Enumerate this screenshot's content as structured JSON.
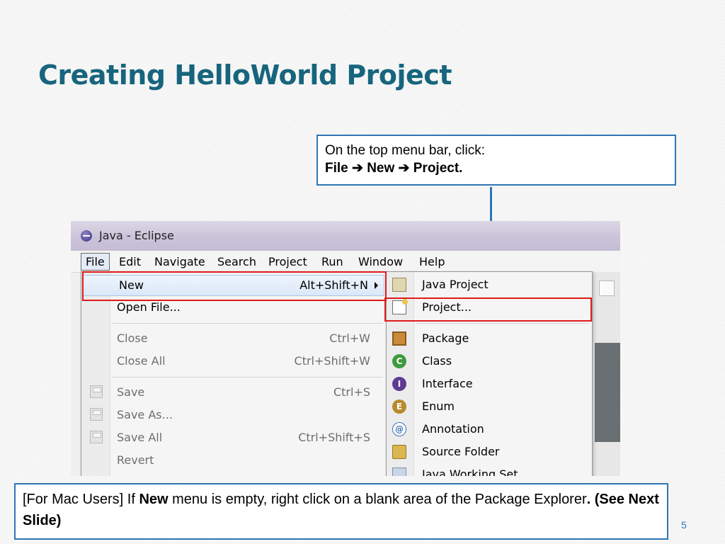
{
  "slide": {
    "title": "Creating HelloWorld Project",
    "page_number": "5"
  },
  "callout_top": {
    "line1": "On the top menu bar, click:",
    "line2": "File ➔ New ➔ Project."
  },
  "callout_bottom": {
    "part1": "[For Mac Users] If ",
    "part2": "New",
    "part3": " menu is empty, right click on a blank area of the Package Explorer",
    "part4": ". (See Next Slide)"
  },
  "eclipse": {
    "window_title": "Java - Eclipse",
    "menubar": [
      "File",
      "Edit",
      "Navigate",
      "Search",
      "Project",
      "Run",
      "Window",
      "Help"
    ],
    "file_menu": [
      {
        "label": "New",
        "shortcut": "Alt+Shift+N",
        "submenu": true,
        "enabled": true
      },
      {
        "label": "Open File...",
        "shortcut": "",
        "enabled": true
      },
      {
        "label": "Close",
        "shortcut": "Ctrl+W",
        "enabled": false
      },
      {
        "label": "Close All",
        "shortcut": "Ctrl+Shift+W",
        "enabled": false
      },
      {
        "label": "Save",
        "shortcut": "Ctrl+S",
        "enabled": false,
        "icon": "save-icon"
      },
      {
        "label": "Save As...",
        "shortcut": "",
        "enabled": false,
        "icon": "save-as-icon"
      },
      {
        "label": "Save All",
        "shortcut": "Ctrl+Shift+S",
        "enabled": false,
        "icon": "save-all-icon"
      },
      {
        "label": "Revert",
        "shortcut": "",
        "enabled": false
      }
    ],
    "new_submenu": [
      {
        "label": "Java Project",
        "icon": "java-project-icon"
      },
      {
        "label": "Project...",
        "icon": "project-icon"
      },
      {
        "label": "Package",
        "icon": "package-icon"
      },
      {
        "label": "Class",
        "icon": "class-icon",
        "glyph": "C"
      },
      {
        "label": "Interface",
        "icon": "interface-icon",
        "glyph": "I"
      },
      {
        "label": "Enum",
        "icon": "enum-icon",
        "glyph": "E"
      },
      {
        "label": "Annotation",
        "icon": "annotation-icon",
        "glyph": "@"
      },
      {
        "label": "Source Folder",
        "icon": "source-folder-icon"
      },
      {
        "label": "Java Working Set",
        "icon": "working-set-icon"
      }
    ]
  },
  "colors": {
    "title": "#17657d",
    "callout_border": "#2e75b6",
    "highlight_box": "#e01b1b"
  }
}
